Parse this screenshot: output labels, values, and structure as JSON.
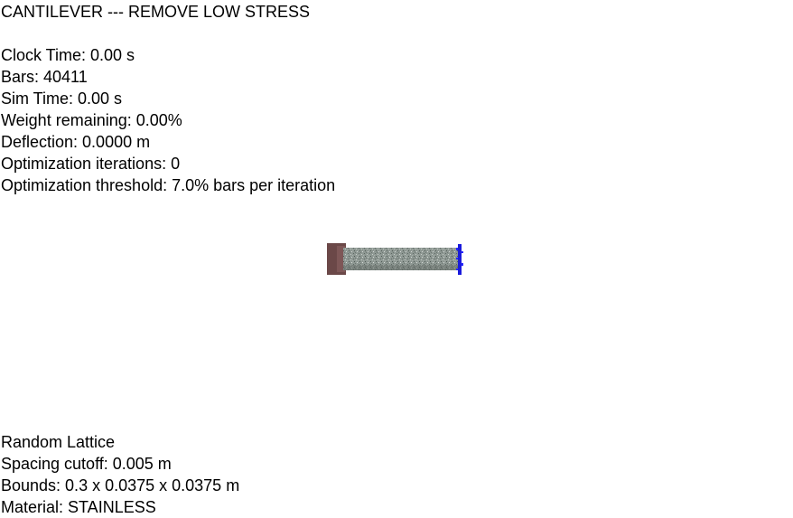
{
  "header": {
    "title": "CANTILEVER --- REMOVE LOW STRESS"
  },
  "stats": {
    "clock_time": "Clock Time: 0.00 s",
    "bars": "Bars: 40411",
    "sim_time": "Sim Time: 0.00 s",
    "weight_remaining": "Weight remaining: 0.00%",
    "deflection": "Deflection: 0.0000 m",
    "optimization_iterations": "Optimization iterations: 0",
    "optimization_threshold": "Optimization threshold: 7.0% bars per iteration"
  },
  "config": {
    "lattice": "Random Lattice",
    "spacing_cutoff": "Spacing cutoff: 0.005 m",
    "bounds": "Bounds: 0.3 x 0.0375 x 0.0375 m",
    "material": "Material: STAINLESS"
  },
  "colors": {
    "background": "#ffffff",
    "text": "#000000",
    "fixed_support": "#6b4848",
    "lattice_body": "#8e9893",
    "load_end": "#1a1adc"
  }
}
